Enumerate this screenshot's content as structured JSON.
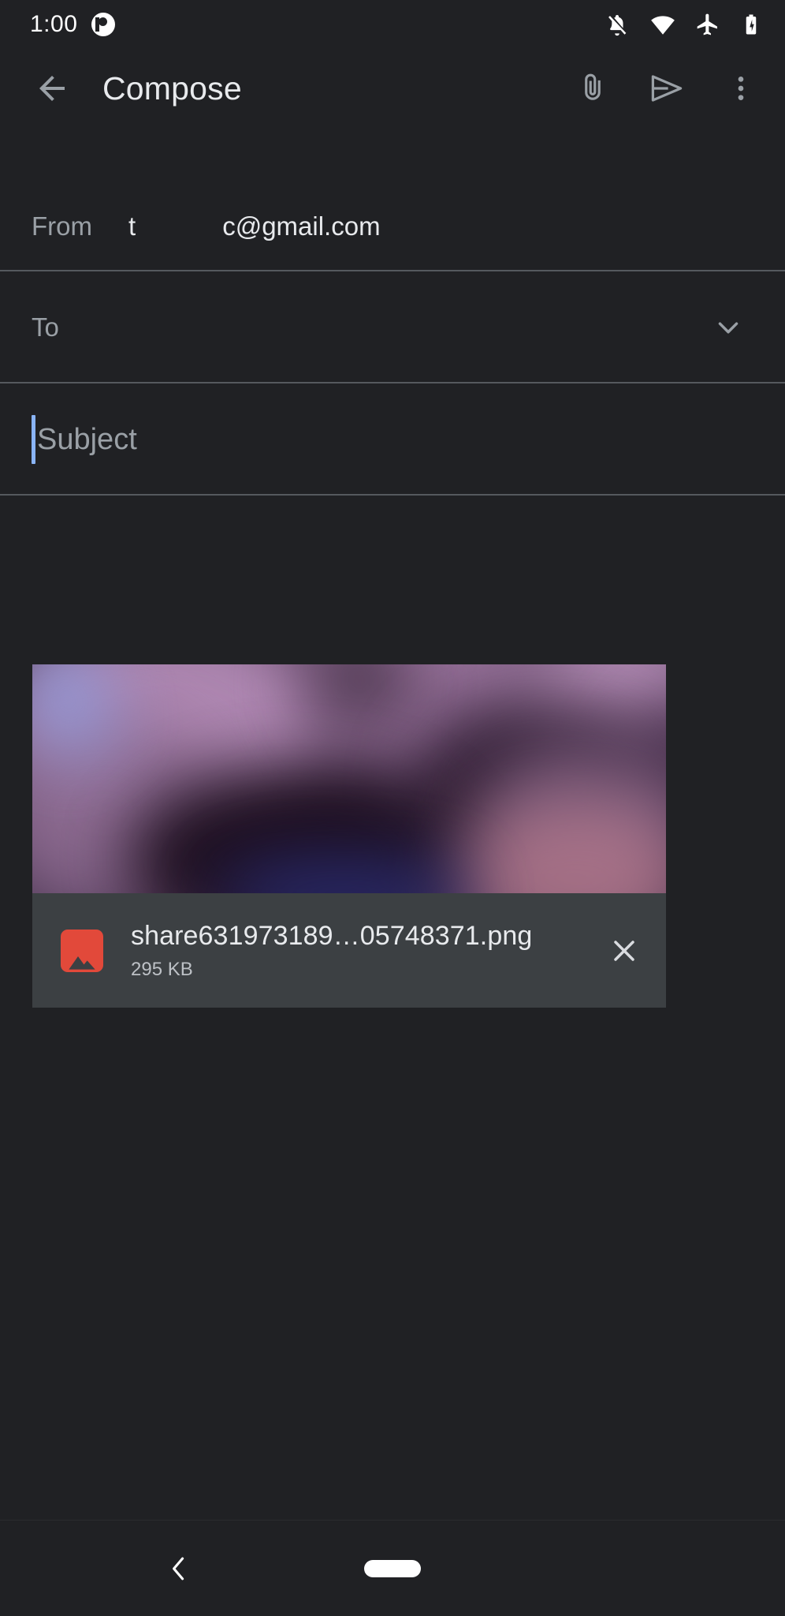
{
  "theme": {
    "background": "#202124",
    "divider": "#5f6368",
    "primary_text": "#e8eaed",
    "secondary_text": "#9aa0a6",
    "caret": "#8ab4f8",
    "card_surface": "#3c4043",
    "file_icon_color": "#e2493a"
  },
  "status_bar": {
    "time": "1:00",
    "app_icon": "clock-app-icon",
    "icons": [
      "notifications-silenced-icon",
      "wifi-icon",
      "airplane-mode-icon",
      "battery-charging-icon"
    ]
  },
  "app_bar": {
    "back_icon": "back-arrow-icon",
    "title": "Compose",
    "actions": [
      {
        "name": "attach-file-button",
        "icon": "paperclip-icon"
      },
      {
        "name": "send-button",
        "icon": "send-icon"
      },
      {
        "name": "more-options-button",
        "icon": "overflow-menu-icon"
      }
    ]
  },
  "compose": {
    "from": {
      "label": "From",
      "value": "t            c@gmail.com"
    },
    "to": {
      "placeholder": "To",
      "value": "",
      "expand_icon": "chevron-down-icon"
    },
    "subject": {
      "placeholder": "Subject",
      "value": ""
    },
    "body": {
      "value": ""
    }
  },
  "attachment": {
    "file_name": "share631973189…05748371.png",
    "file_size": "295 KB",
    "file_type_icon": "image-file-icon",
    "remove_icon": "close-icon",
    "thumbnail": "blurred-purple-photo"
  },
  "nav_bar": {
    "back_icon": "chevron-back-icon",
    "home_indicator": "home-pill-indicator"
  }
}
